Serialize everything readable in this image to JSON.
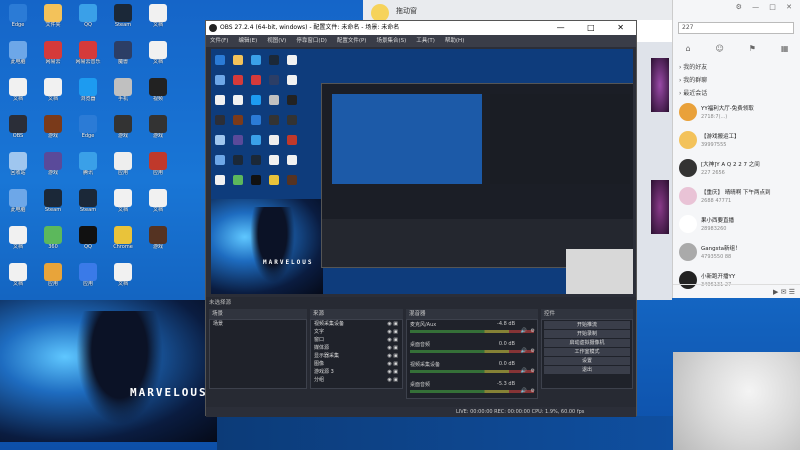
{
  "desktop_icons": [
    {
      "label": "Edge",
      "color": "#2b7bd6"
    },
    {
      "label": "文件夹",
      "color": "#f3c25a"
    },
    {
      "label": "QQ",
      "color": "#3aa0e8"
    },
    {
      "label": "Steam",
      "color": "#1b2838"
    },
    {
      "label": "文档",
      "color": "#f1f1f1"
    },
    {
      "label": "此电脑",
      "color": "#6da7e8"
    },
    {
      "label": "网易云",
      "color": "#d53a3a"
    },
    {
      "label": "网易云音乐",
      "color": "#d53a3a"
    },
    {
      "label": "魔兽",
      "color": "#2c3e66"
    },
    {
      "label": "文档",
      "color": "#f1f1f1"
    },
    {
      "label": "文档",
      "color": "#f1f1f1"
    },
    {
      "label": "文档",
      "color": "#f1f1f1"
    },
    {
      "label": "浏览器",
      "color": "#1d9bf0"
    },
    {
      "label": "手机",
      "color": "#c0c0c0"
    },
    {
      "label": "视频",
      "color": "#222222"
    },
    {
      "label": "OBS",
      "color": "#2b2e38"
    },
    {
      "label": "游戏",
      "color": "#7a3a1a"
    },
    {
      "label": "Edge",
      "color": "#2b7bd6"
    },
    {
      "label": "游戏",
      "color": "#333333"
    },
    {
      "label": "游戏",
      "color": "#333333"
    },
    {
      "label": "回收站",
      "color": "#9fc6ef"
    },
    {
      "label": "游戏",
      "color": "#5a4a9a"
    },
    {
      "label": "腾讯",
      "color": "#3aa0e8"
    },
    {
      "label": "应用",
      "color": "#eeeeee"
    },
    {
      "label": "应用",
      "color": "#c0392b"
    },
    {
      "label": "此电脑",
      "color": "#6da7e8"
    },
    {
      "label": "Steam",
      "color": "#1b2838"
    },
    {
      "label": "Steam",
      "color": "#1b2838"
    },
    {
      "label": "文档",
      "color": "#f1f1f1"
    },
    {
      "label": "文档",
      "color": "#f1f1f1"
    },
    {
      "label": "文档",
      "color": "#f1f1f1"
    },
    {
      "label": "360",
      "color": "#5cb85c"
    },
    {
      "label": "QQ",
      "color": "#111111"
    },
    {
      "label": "Chrome",
      "color": "#e9c33a"
    },
    {
      "label": "游戏",
      "color": "#553322"
    },
    {
      "label": "文档",
      "color": "#f1f1f1"
    },
    {
      "label": "应用",
      "color": "#e8a43a"
    },
    {
      "label": "应用",
      "color": "#3a7ae8"
    },
    {
      "label": "文档",
      "color": "#f1f1f1"
    }
  ],
  "wallpaper": {
    "brand": "MARVELOUS"
  },
  "obs": {
    "title": "OBS 27.2.4 (64-bit, windows) - 配置文件: 未命名 - 场景: 未命名",
    "menu": [
      "文件(F)",
      "编辑(E)",
      "视图(V)",
      "停靠窗口(D)",
      "配置文件(P)",
      "场景集合(S)",
      "工具(T)",
      "帮助(H)"
    ],
    "docks": {
      "scenes": "场景",
      "sources": "来源",
      "mixer": "混音器",
      "controls": "控件",
      "source_missing": "未选择源"
    },
    "scene_items": [
      "场景"
    ],
    "sources": [
      "视频采集设备",
      "文字",
      "窗口",
      "媒体源",
      "显示器采集",
      "图像",
      "游戏源 3",
      "分组"
    ],
    "mixer": [
      {
        "name": "麦克风/Aux",
        "db": "-4.8 dB"
      },
      {
        "name": "桌面音频",
        "db": "0.0 dB"
      },
      {
        "name": "视频采集设备",
        "db": "0.0 dB"
      },
      {
        "name": "桌面音频",
        "db": "-5.3 dB"
      }
    ],
    "controls": [
      "开始推流",
      "开始录制",
      "启动虚拟摄像机",
      "工作室模式",
      "设置",
      "退出"
    ],
    "status": "LIVE: 00:00:00   REC: 00:00:00   CPU: 1.9%, 60.00 fps"
  },
  "chat": {
    "contact_name": "拖动窗"
  },
  "qq": {
    "search": "227",
    "groups": [
      "我的好友",
      "我的群聊",
      "最近会话"
    ],
    "contacts": [
      {
        "name": "YY福利大厅-免费领取",
        "sub": "2718:7(...)",
        "color": "#e9a13a"
      },
      {
        "name": "【游戏搬运工】",
        "sub": "39997555",
        "color": "#f3c25a"
      },
      {
        "name": "[大神]Y A Q 2 2 7 之间",
        "sub": "227   2656",
        "color": "#333333"
      },
      {
        "name": "【重庆】 晴晴啊 下午两点到",
        "sub": "2688   47771",
        "color": "#e9c3d6"
      },
      {
        "name": "果小西要直播",
        "sub": "28983260",
        "color": "#ffffff"
      },
      {
        "name": "Gangsta新组！",
        "sub": "4793550   88",
        "color": "#aaaaaa"
      },
      {
        "name": "小新跑开播YY",
        "sub": "3496131   27",
        "color": "#222222"
      }
    ]
  }
}
